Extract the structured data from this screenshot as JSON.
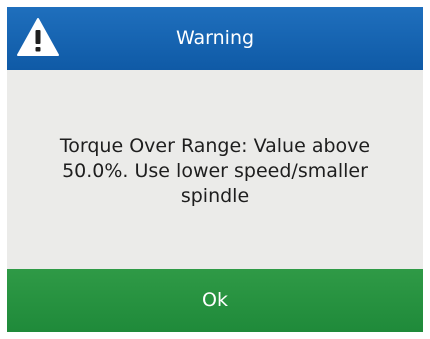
{
  "dialog": {
    "icon": "warning-triangle-icon",
    "title": "Warning",
    "message": "Torque Over Range: Value above 50.0%. Use lower speed/smaller spindle",
    "ok_label": "Ok"
  },
  "colors": {
    "header": "#1565b2",
    "body": "#ebebe9",
    "button": "#26913f",
    "text_light": "#ffffff",
    "text_dark": "#1e1e1e"
  }
}
